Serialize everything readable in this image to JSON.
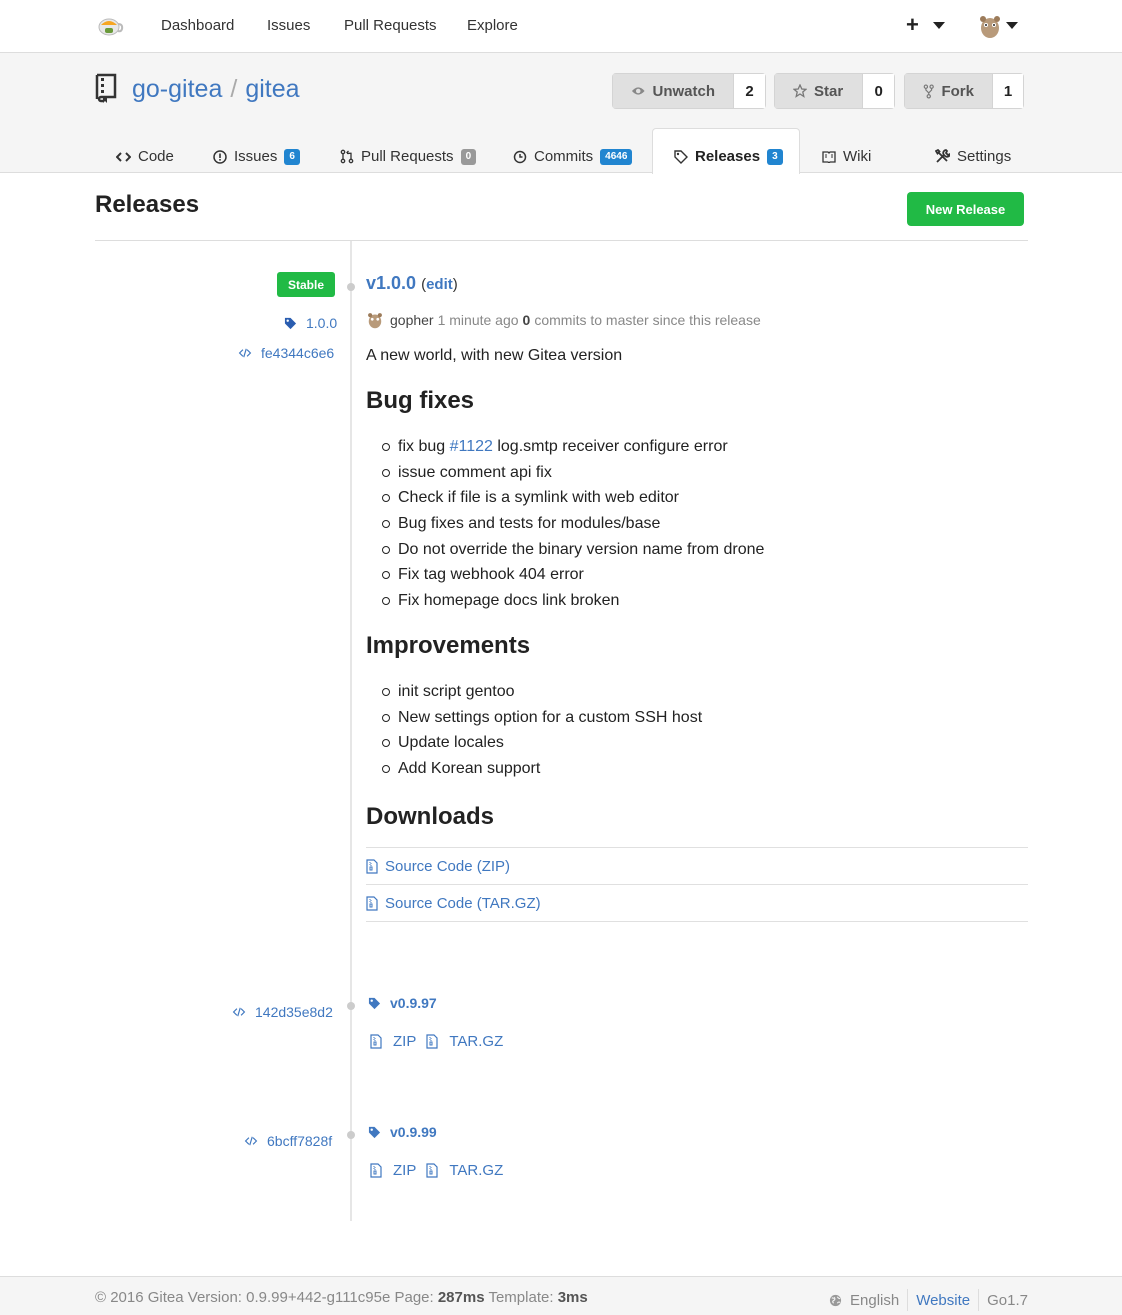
{
  "nav": {
    "items": [
      "Dashboard",
      "Issues",
      "Pull Requests",
      "Explore"
    ],
    "plus": "+"
  },
  "repo": {
    "owner": "go-gitea",
    "separator": "/",
    "name": "gitea",
    "watch": {
      "label": "Unwatch",
      "count": "2"
    },
    "star": {
      "label": "Star",
      "count": "0"
    },
    "fork": {
      "label": "Fork",
      "count": "1"
    }
  },
  "tabs": [
    {
      "label": "Code",
      "icon": "code-icon"
    },
    {
      "label": "Issues",
      "badge": "6",
      "icon": "issue-opened-icon"
    },
    {
      "label": "Pull Requests",
      "badge": "0",
      "icon": "git-pull-request-icon"
    },
    {
      "label": "Commits",
      "badge": "4646",
      "icon": "history-icon"
    },
    {
      "label": "Releases",
      "badge": "3",
      "icon": "tag-icon",
      "active": true
    },
    {
      "label": "Wiki",
      "icon": "book-icon"
    },
    {
      "label": "Settings",
      "icon": "tools-icon"
    }
  ],
  "page": {
    "title": "Releases",
    "new_release": "New Release"
  },
  "latest": {
    "stable_label": "Stable",
    "tag": "1.0.0",
    "commit": "fe4344c6e6",
    "title": "v1.0.0",
    "edit_open": "(",
    "edit": "edit",
    "edit_close": ")",
    "author": "gopher",
    "time": "1 minute ago",
    "commits_count": "0",
    "commits_text": "commits to master since this release",
    "description": "A new world, with new Gitea version",
    "bugfix_heading": "Bug fixes",
    "bugfix_first_prefix": "fix bug ",
    "bugfix_first_link": "#1122",
    "bugfix_first_suffix": " log.smtp receiver configure error",
    "bugfixes": [
      "issue comment api fix",
      "Check if file is a symlink with web editor",
      "Bug fixes and tests for modules/base",
      "Do not override the binary version name from drone",
      "Fix tag webhook 404 error",
      "Fix homepage docs link broken"
    ],
    "improvements_heading": "Improvements",
    "improvements": [
      "init script gentoo",
      "New settings option for a custom SSH host",
      "Update locales",
      "Add Korean support"
    ],
    "downloads_heading": "Downloads",
    "downloads": [
      "Source Code (ZIP)",
      "Source Code (TAR.GZ)"
    ]
  },
  "older": [
    {
      "commit": "142d35e8d2",
      "tag": "v0.9.97",
      "zip": "ZIP",
      "targz": "TAR.GZ"
    },
    {
      "commit": "6bcff7828f",
      "tag": "v0.9.99",
      "zip": "ZIP",
      "targz": "TAR.GZ"
    }
  ],
  "footer": {
    "copyright": "© 2016 Gitea Version: 0.9.99+442-g111c95e Page:",
    "page_time": "287ms",
    "template_label": "Template:",
    "template_time": "3ms",
    "language": "English",
    "website": "Website",
    "go_version": "Go1.7"
  },
  "colors": {
    "accent": "#4078c0",
    "badge": "#2185d0",
    "green": "#21ba45"
  }
}
